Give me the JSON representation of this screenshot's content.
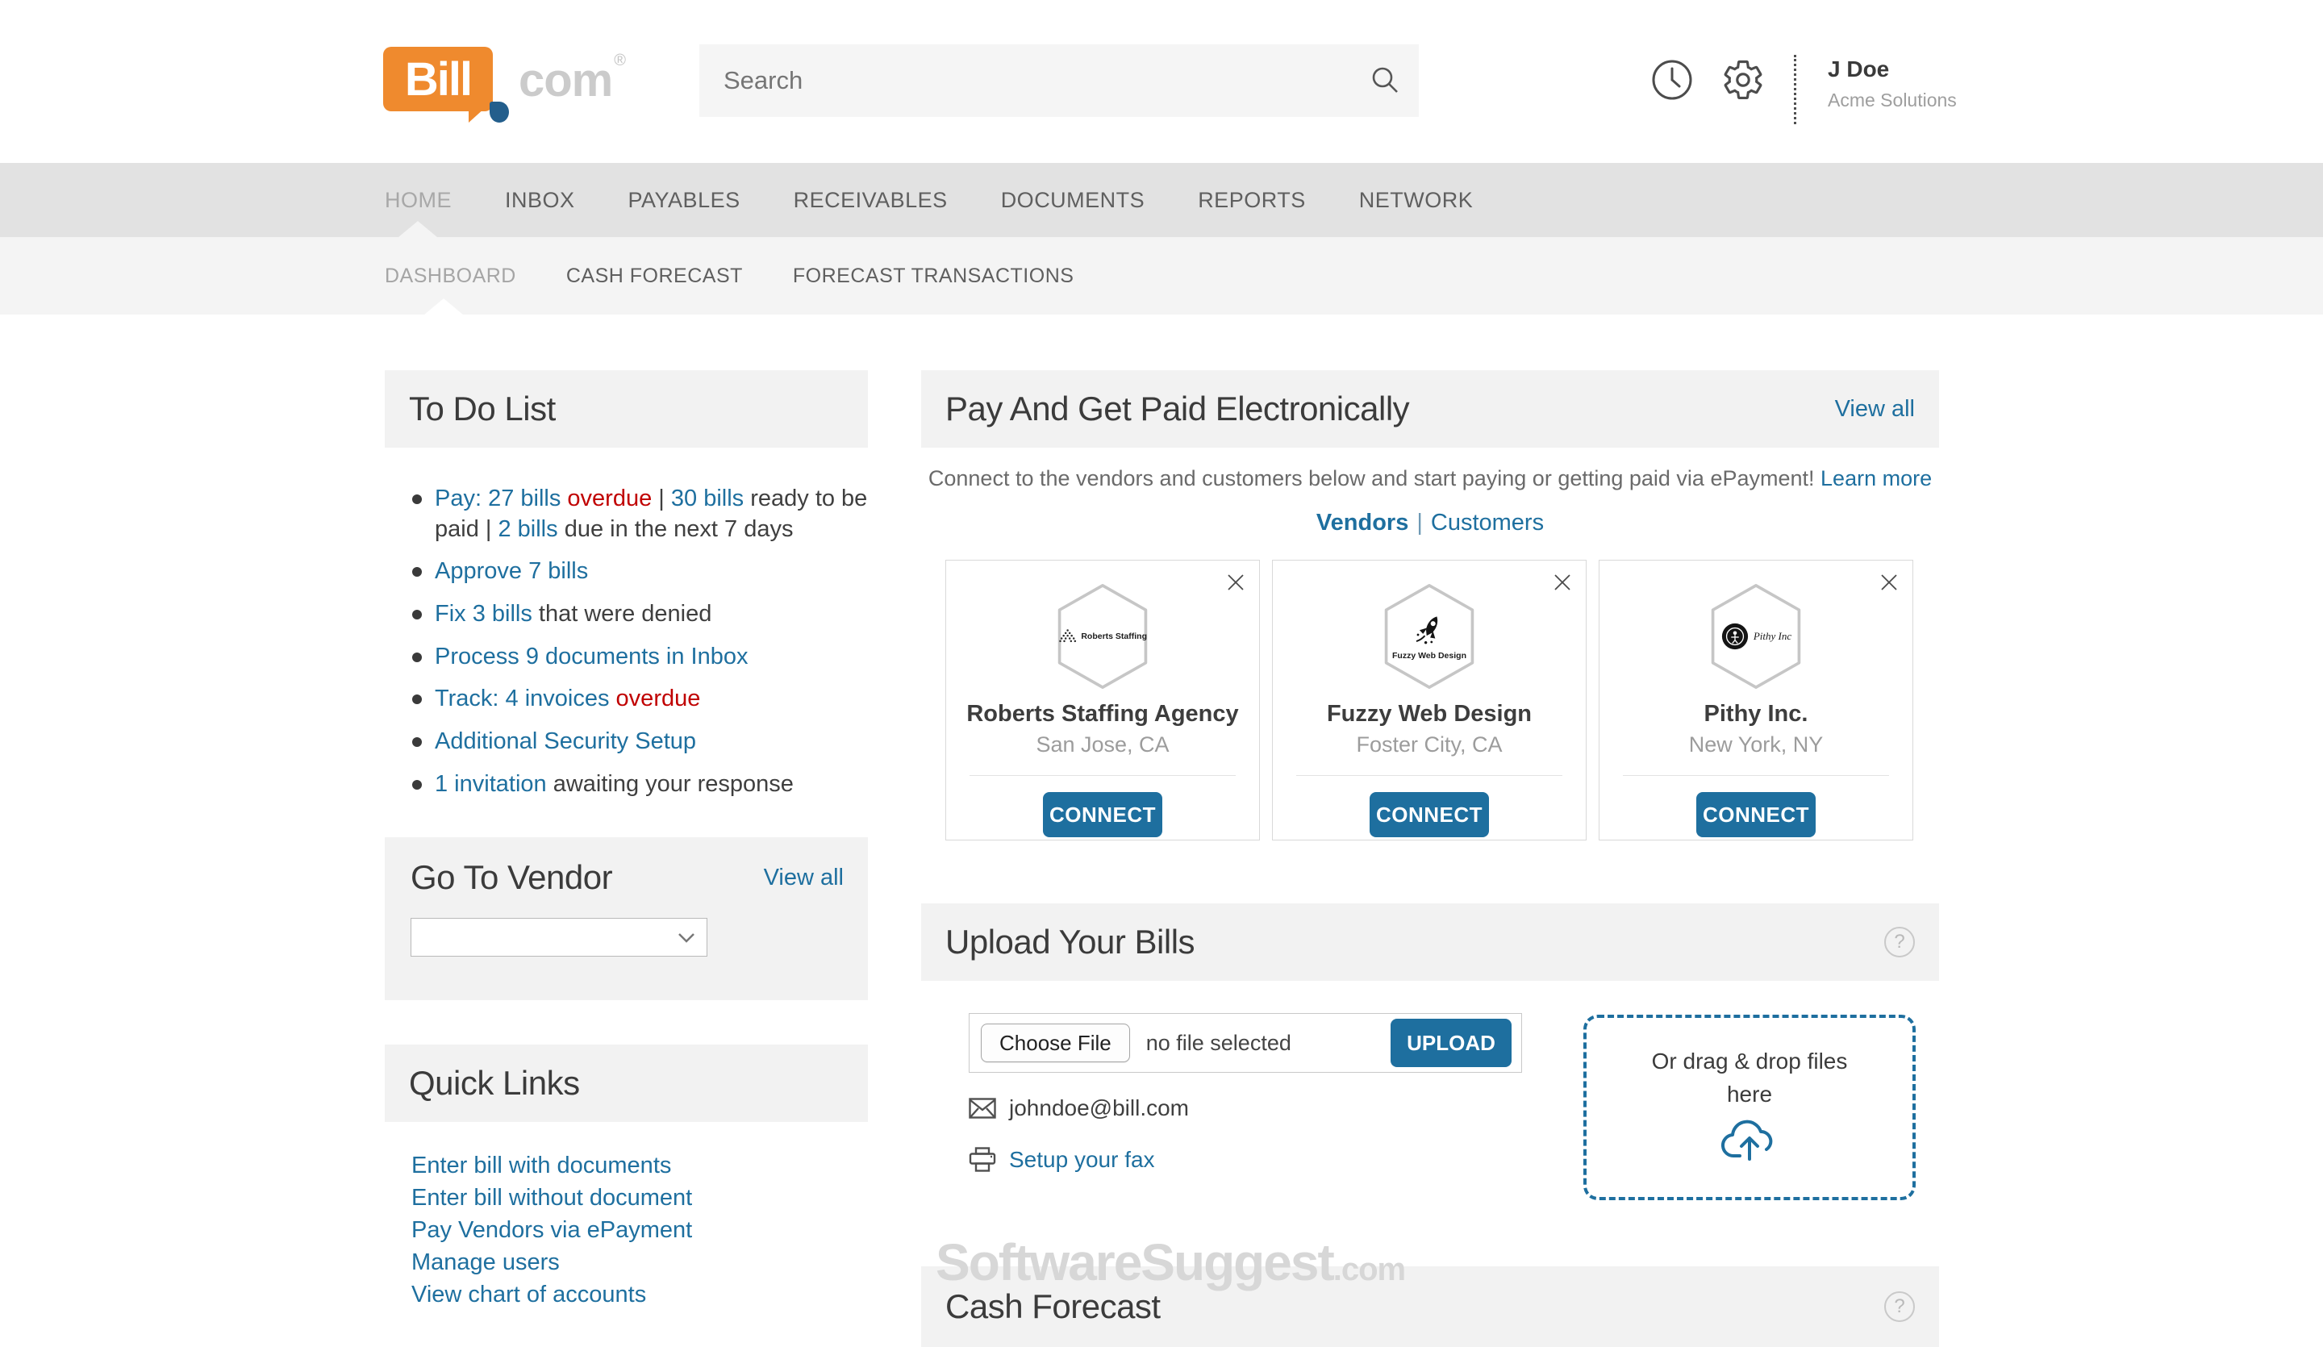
{
  "colors": {
    "accent_blue": "#1e6f9f",
    "alert_red": "#c00000",
    "logo_orange": "#ef8a2e",
    "logo_dot_blue": "#235e8c",
    "panel_header_bg": "#f2f2f2",
    "nav_bg": "#e2e2e2",
    "subnav_bg": "#f4f4f4"
  },
  "header": {
    "logo": {
      "bill": "Bill",
      "com": "com",
      "registered": "®"
    },
    "search": {
      "placeholder": "Search"
    },
    "icons": [
      "clock-icon",
      "gear-icon"
    ],
    "user": {
      "name": "J Doe",
      "company": "Acme Solutions"
    }
  },
  "nav": {
    "items": [
      {
        "label": "HOME",
        "active": true
      },
      {
        "label": "INBOX"
      },
      {
        "label": "PAYABLES"
      },
      {
        "label": "RECEIVABLES"
      },
      {
        "label": "DOCUMENTS"
      },
      {
        "label": "REPORTS"
      },
      {
        "label": "NETWORK"
      }
    ]
  },
  "subnav": {
    "items": [
      {
        "label": "DASHBOARD",
        "active": true
      },
      {
        "label": "CASH FORECAST"
      },
      {
        "label": "FORECAST TRANSACTIONS"
      }
    ]
  },
  "todo": {
    "title": "To Do List",
    "items": [
      {
        "segments": [
          {
            "text": "Pay: 27 bills",
            "style": "link"
          },
          {
            "text": " overdue",
            "style": "alert"
          },
          {
            "text": " | ",
            "style": "plain"
          },
          {
            "text": "30 bills",
            "style": "link"
          },
          {
            "text": " ready to be paid | ",
            "style": "plain"
          },
          {
            "text": "2 bills",
            "style": "link"
          },
          {
            "text": " due in the next 7 days",
            "style": "plain"
          }
        ]
      },
      {
        "segments": [
          {
            "text": "Approve 7 bills",
            "style": "link"
          }
        ]
      },
      {
        "segments": [
          {
            "text": "Fix 3 bills",
            "style": "link"
          },
          {
            "text": " that were denied",
            "style": "plain"
          }
        ]
      },
      {
        "segments": [
          {
            "text": "Process 9 documents in Inbox",
            "style": "link"
          }
        ]
      },
      {
        "segments": [
          {
            "text": "Track: 4 invoices",
            "style": "link"
          },
          {
            "text": " overdue",
            "style": "alert"
          }
        ]
      },
      {
        "segments": [
          {
            "text": "Additional Security Setup",
            "style": "link"
          }
        ]
      },
      {
        "segments": [
          {
            "text": "1 invitation",
            "style": "link"
          },
          {
            "text": " awaiting your response",
            "style": "plain"
          }
        ]
      }
    ]
  },
  "pay": {
    "title": "Pay And Get Paid Electronically",
    "view_all": "View all",
    "intro_text": "Connect to the vendors and customers below and start paying or getting paid via ePayment! ",
    "learn_more": "Learn more",
    "tabs": {
      "vendors": "Vendors",
      "separator": "|",
      "customers": "Customers"
    },
    "connect_label": "CONNECT",
    "cards": [
      {
        "name": "Roberts Staffing Agency",
        "location": "San Jose, CA",
        "logo": "roberts",
        "logo_text": "Roberts Staffing"
      },
      {
        "name": "Fuzzy Web Design",
        "location": "Foster City, CA",
        "logo": "fuzzy",
        "logo_text": "Fuzzy Web Design"
      },
      {
        "name": "Pithy Inc.",
        "location": "New York, NY",
        "logo": "pithy",
        "logo_text": "Pithy Inc"
      }
    ]
  },
  "goto_vendor": {
    "title": "Go To Vendor",
    "view_all": "View all",
    "select_value": ""
  },
  "quick_links": {
    "title": "Quick Links",
    "links": [
      "Enter bill with documents",
      "Enter bill without document",
      "Pay Vendors via ePayment",
      "Manage users",
      "View chart of accounts"
    ]
  },
  "upload": {
    "title": "Upload Your Bills",
    "help": "?",
    "choose_file_label": "Choose File",
    "file_status": "no file selected",
    "upload_button": "UPLOAD",
    "email": "johndoe@bill.com",
    "fax_link": "Setup your fax",
    "dropzone_line1": "Or drag & drop files",
    "dropzone_line2": "here"
  },
  "cash_forecast": {
    "title": "Cash Forecast",
    "help": "?"
  },
  "watermark": {
    "main": "SoftwareSuggest",
    "suffix": ".com"
  }
}
